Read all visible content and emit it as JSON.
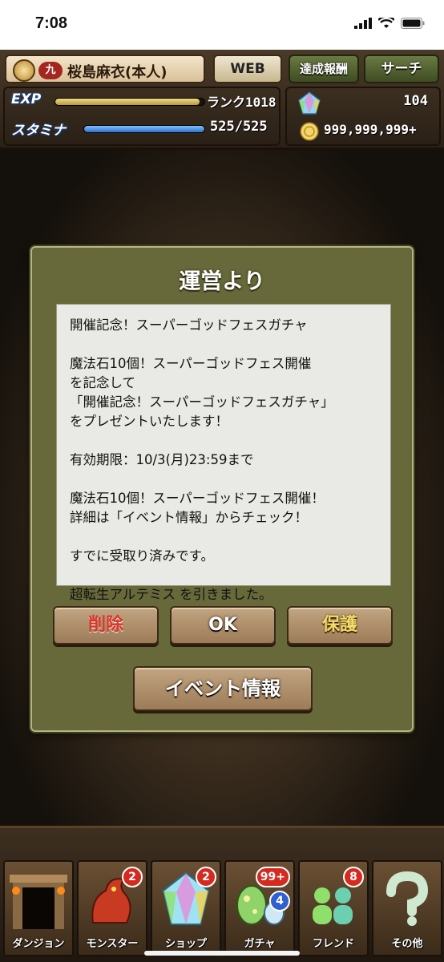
{
  "status_bar": {
    "time": "7:08"
  },
  "hud": {
    "rank_badge": "九",
    "player_name": "桜島麻衣(本人)",
    "buttons": {
      "web": "WEB",
      "reward": "達成報酬",
      "search": "サーチ"
    },
    "exp_label": "EXP",
    "rank_text": "ランク1018",
    "exp_progress": 0.97,
    "stamina_label": "スタミナ",
    "stamina_value": "525/525",
    "stamina_progress": 1.0,
    "magic_stones": "104",
    "coins": "999,999,999+"
  },
  "dialog": {
    "title": "運営より",
    "message_lines": [
      "開催記念！スーパーゴッドフェスガチャ",
      "",
      "魔法石10個！スーパーゴッドフェス開催",
      "を記念して",
      "「開催記念！スーパーゴッドフェスガチャ」",
      "をプレゼントいたします！",
      "",
      "有効期限：10/3(月)23:59まで",
      "",
      "魔法石10個！スーパーゴッドフェス開催！",
      "詳細は「イベント情報」からチェック！",
      "",
      "すでに受取り済みです。",
      "",
      "超転生アルテミス を引きました。"
    ],
    "buttons": {
      "delete": "削除",
      "ok": "OK",
      "protect": "保護",
      "event_info": "イベント情報"
    }
  },
  "bottom_nav": [
    {
      "label": "ダンジョン",
      "icon": "dungeon-gate-icon",
      "badge": "",
      "badge2": ""
    },
    {
      "label": "モンスター",
      "icon": "red-dragon-icon",
      "badge": "2",
      "badge2": ""
    },
    {
      "label": "ショップ",
      "icon": "rainbow-stone-icon",
      "badge": "2",
      "badge2": ""
    },
    {
      "label": "ガチャ",
      "icon": "egg-icon",
      "badge": "99+",
      "badge2": "4"
    },
    {
      "label": "フレンド",
      "icon": "friends-icon",
      "badge": "8",
      "badge2": ""
    },
    {
      "label": "その他",
      "icon": "question-icon",
      "badge": "",
      "badge2": ""
    }
  ],
  "colors": {
    "dialog_bg": "#67693a",
    "message_bg": "#e9e9e5",
    "delete_text": "#d8362a",
    "protect_text": "#f4d96a",
    "exp_gauge": "#d9c36a",
    "stamina_gauge": "#3d8ee0",
    "badge_red": "#d42a1f",
    "badge_blue": "#2f5fd0"
  }
}
